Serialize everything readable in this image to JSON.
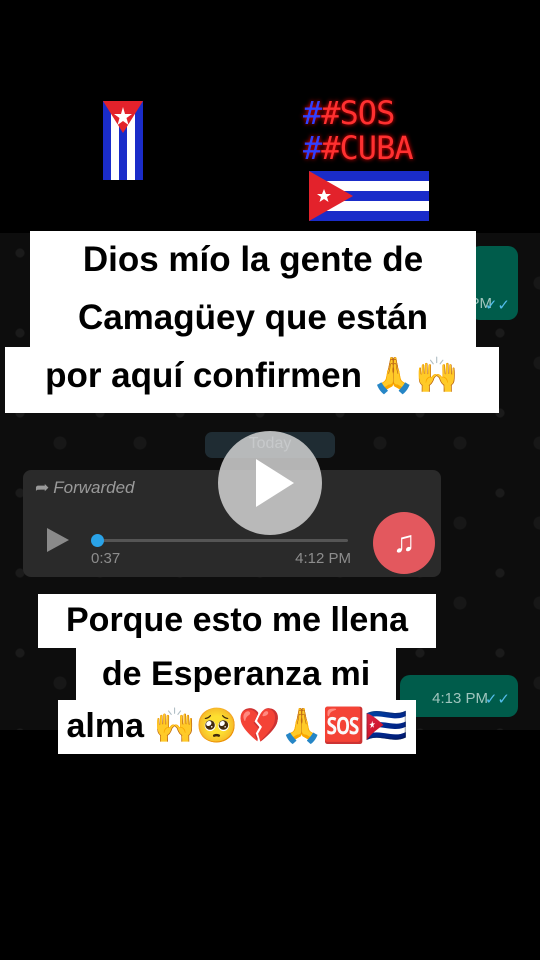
{
  "overlay_top": {
    "hashtag_line1": "#SOS",
    "hashtag_line2": "#CUBA"
  },
  "chat": {
    "outgoing_top": {
      "time": "PM",
      "ticks": "✓✓"
    },
    "date_divider": "Today",
    "audio_message": {
      "forwarded_label": "Forwarded",
      "duration": "0:37",
      "time": "4:12 PM",
      "progress": 0.0,
      "play_icon": "play-icon",
      "music_icon": "music-note-icon"
    },
    "outgoing_bottom": {
      "time": "4:13 PM",
      "ticks": "✓✓"
    }
  },
  "captions": {
    "caption1_lines": [
      "Dios mío  la gente de",
      "Camagüey que están",
      "por aquí confirmen 🙏🙌"
    ],
    "caption2_lines": [
      "Porque esto me llena",
      "de Esperanza mi",
      "alma 🙌🥺💔🙏🆘🇨🇺"
    ]
  },
  "video_control": {
    "play_icon": "play-icon"
  },
  "colors": {
    "outgoing_bubble": "#005c4b",
    "audio_bubble": "#2a2a2a",
    "music_accent": "#e3585e",
    "progress_accent": "#2aa3e8",
    "ticks": "#53bdeb",
    "flag_red": "#e3222b",
    "flag_blue": "#1a2cc9"
  }
}
